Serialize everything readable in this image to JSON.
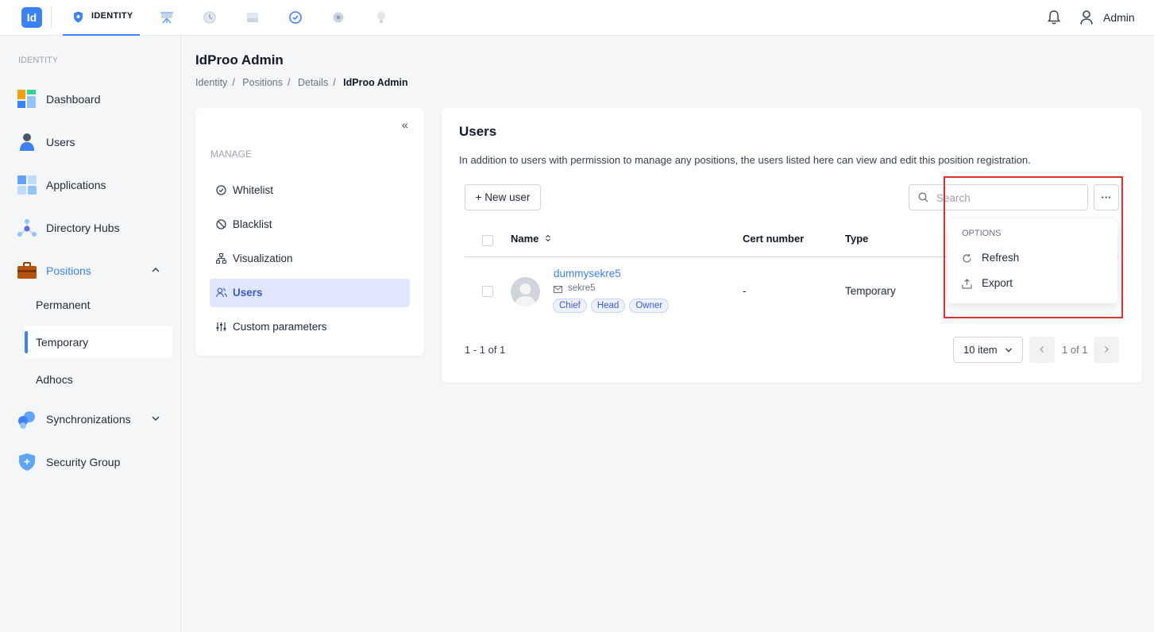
{
  "topbar": {
    "logo": "Id",
    "active_tab": "IDENTITY",
    "user": "Admin"
  },
  "sidebar": {
    "section": "IDENTITY",
    "items": [
      {
        "label": "Dashboard"
      },
      {
        "label": "Users"
      },
      {
        "label": "Applications"
      },
      {
        "label": "Directory Hubs"
      },
      {
        "label": "Positions"
      },
      {
        "label": "Synchronizations"
      },
      {
        "label": "Security Group"
      }
    ],
    "positions_sub": [
      {
        "label": "Permanent"
      },
      {
        "label": "Temporary"
      },
      {
        "label": "Adhocs"
      }
    ]
  },
  "page": {
    "title": "IdProo Admin",
    "breadcrumb": [
      "Identity",
      "Positions",
      "Details",
      "IdProo Admin"
    ]
  },
  "manage": {
    "collapse": "«",
    "label": "MANAGE",
    "items": [
      {
        "label": "Whitelist"
      },
      {
        "label": "Blacklist"
      },
      {
        "label": "Visualization"
      },
      {
        "label": "Users"
      },
      {
        "label": "Custom parameters"
      }
    ]
  },
  "users": {
    "title": "Users",
    "description": "In addition to users with permission to manage any positions, the users listed here can view and edit this position registration.",
    "new_user": "+ New user",
    "search_placeholder": "Search",
    "more": "···",
    "columns": {
      "name": "Name",
      "cert": "Cert number",
      "type": "Type"
    },
    "rows": [
      {
        "name": "dummysekre5",
        "email": "sekre5",
        "tags": [
          "Chief",
          "Head",
          "Owner"
        ],
        "cert": "-",
        "type": "Temporary"
      }
    ],
    "count": "1 - 1 of 1",
    "page_size": "10 item",
    "page_info": "1 of 1"
  },
  "options_menu": {
    "label": "OPTIONS",
    "items": [
      {
        "label": "Refresh"
      },
      {
        "label": "Export"
      }
    ]
  }
}
